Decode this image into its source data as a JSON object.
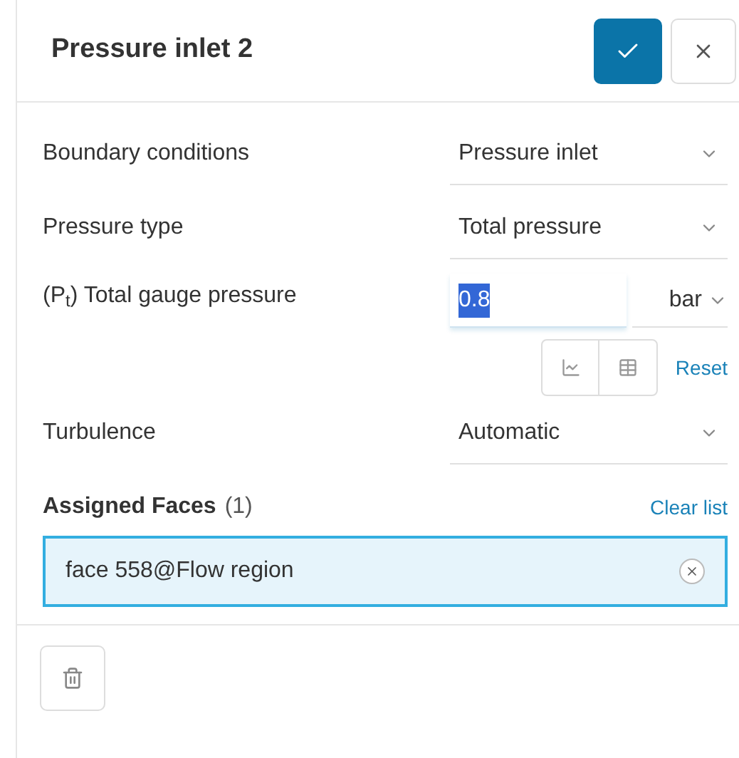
{
  "title": "Pressure inlet 2",
  "fields": [
    {
      "kind": "select",
      "label": "Boundary conditions",
      "value": "Pressure inlet"
    },
    {
      "kind": "select",
      "label": "Pressure type",
      "value": "Total pressure"
    },
    {
      "kind": "number",
      "label": "(P$_{t}$) Total gauge pressure",
      "value": "0.8",
      "highlighted": true,
      "unit": "bar",
      "reset": "Reset"
    },
    {
      "kind": "select",
      "label": "Turbulence",
      "value": "Automatic"
    }
  ],
  "assigned": {
    "title": "Assigned Faces",
    "count": "(1)",
    "clear": "Clear list",
    "items": [
      {
        "label": "face 558@Flow region",
        "selected": true
      }
    ]
  }
}
